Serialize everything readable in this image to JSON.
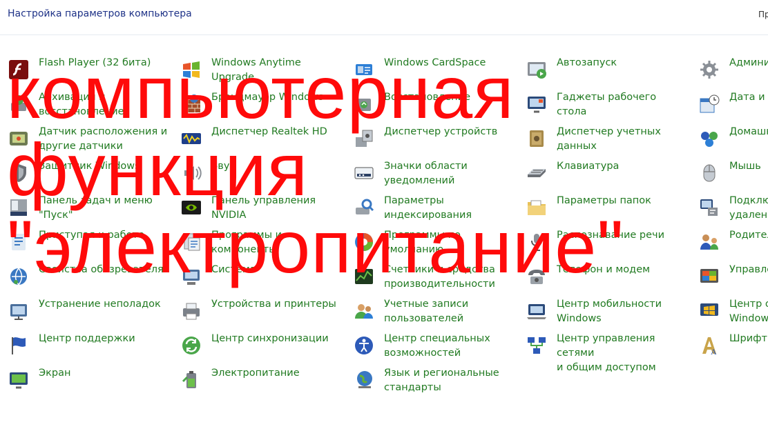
{
  "header": {
    "title": "Настройка параметров компьютера",
    "right_clipped": "Пр"
  },
  "colors": {
    "title": "#1e3287",
    "link": "#217a21",
    "overlay": "#ff0a0a"
  },
  "columns": [
    [
      {
        "name": "flash-player",
        "icon": "flash-player-icon",
        "label": "Flash Player (32 бита)"
      },
      {
        "name": "backup-restore",
        "icon": "backup-restore-icon",
        "label": "Архивация и\nвосстановление"
      },
      {
        "name": "location-sensors",
        "icon": "location-sensor-icon",
        "label": "Датчик расположения и\nдругие датчики"
      },
      {
        "name": "windows-defender",
        "icon": "defender-icon",
        "label": "Защитник Windows"
      },
      {
        "name": "taskbar-start-menu",
        "icon": "taskbar-icon",
        "label": "Панель задач и меню\n\"Пуск\""
      },
      {
        "name": "getting-started",
        "icon": "getting-started-icon",
        "label": "Приступая к работе"
      },
      {
        "name": "internet-options",
        "icon": "internet-options-icon",
        "label": "Свойства обозревателя"
      },
      {
        "name": "troubleshooting",
        "icon": "troubleshooting-icon",
        "label": "Устранение неполадок"
      },
      {
        "name": "action-center",
        "icon": "action-center-flag-icon",
        "label": "Центр поддержки"
      },
      {
        "name": "display",
        "icon": "display-icon",
        "label": "Экран"
      }
    ],
    [
      {
        "name": "windows-anytime-upgrade",
        "icon": "windows-logo-icon",
        "label": "Windows Anytime\nUpgrade"
      },
      {
        "name": "windows-firewall",
        "icon": "firewall-icon",
        "label": "Брандмауэр Windows"
      },
      {
        "name": "realtek-hd-manager",
        "icon": "realtek-icon",
        "label": "Диспетчер Realtek HD"
      },
      {
        "name": "sound",
        "icon": "speaker-icon",
        "label": "Звук"
      },
      {
        "name": "nvidia-control-panel",
        "icon": "nvidia-icon",
        "label": "Панель управления\nNVIDIA"
      },
      {
        "name": "programs-features",
        "icon": "programs-icon",
        "label": "Программы и\nкомпоненты"
      },
      {
        "name": "system",
        "icon": "system-icon",
        "label": "Система"
      },
      {
        "name": "devices-printers",
        "icon": "printer-icon",
        "label": "Устройства и принтеры"
      },
      {
        "name": "sync-center",
        "icon": "sync-icon",
        "label": "Центр синхронизации"
      },
      {
        "name": "power-options",
        "icon": "power-icon",
        "label": "Электропитание"
      }
    ],
    [
      {
        "name": "windows-cardspace",
        "icon": "cardspace-icon",
        "label": "Windows CardSpace"
      },
      {
        "name": "recovery",
        "icon": "recovery-icon",
        "label": "Восстановление"
      },
      {
        "name": "device-manager",
        "icon": "device-manager-icon",
        "label": "Диспетчер устройств"
      },
      {
        "name": "notification-area-icons",
        "icon": "notification-area-icon",
        "label": "Значки области\nуведомлений"
      },
      {
        "name": "indexing-options",
        "icon": "indexing-icon",
        "label": "Параметры\nиндексирования"
      },
      {
        "name": "default-programs",
        "icon": "default-programs-icon",
        "label": "Программы по\nумолчанию"
      },
      {
        "name": "performance-tools",
        "icon": "performance-icon",
        "label": "Счетчики и средства\nпроизводительности"
      },
      {
        "name": "user-accounts",
        "icon": "user-accounts-icon",
        "label": "Учетные записи\nпользователей"
      },
      {
        "name": "ease-of-access",
        "icon": "accessibility-icon",
        "label": "Центр специальных\nвозможностей"
      },
      {
        "name": "region-language",
        "icon": "globe-icon",
        "label": "Язык и региональные\nстандарты"
      }
    ],
    [
      {
        "name": "autoplay",
        "icon": "autoplay-icon",
        "label": "Автозапуск"
      },
      {
        "name": "desktop-gadgets",
        "icon": "gadgets-icon",
        "label": "Гаджеты рабочего стола"
      },
      {
        "name": "credential-manager",
        "icon": "credential-safe-icon",
        "label": "Диспетчер учетных\nданных"
      },
      {
        "name": "keyboard",
        "icon": "keyboard-icon",
        "label": "Клавиатура"
      },
      {
        "name": "folder-options",
        "icon": "folder-icon",
        "label": "Параметры папок"
      },
      {
        "name": "speech-recognition",
        "icon": "microphone-icon",
        "label": "Распознавание речи"
      },
      {
        "name": "phone-modem",
        "icon": "phone-icon",
        "label": "Телефон и модем"
      },
      {
        "name": "windows-mobility-center",
        "icon": "mobility-icon",
        "label": "Центр мобильности\nWindows"
      },
      {
        "name": "network-sharing-center",
        "icon": "network-icon",
        "label": "Центр управления сетями\nи общим доступом"
      }
    ],
    [
      {
        "name": "administrative-tools",
        "icon": "admin-tools-icon",
        "label": "Админи"
      },
      {
        "name": "date-time",
        "icon": "calendar-clock-icon",
        "label": "Дата и в"
      },
      {
        "name": "homegroup",
        "icon": "homegroup-icon",
        "label": "Домашн"
      },
      {
        "name": "mouse",
        "icon": "mouse-icon",
        "label": "Мышь"
      },
      {
        "name": "remoteapp-connections",
        "icon": "remote-connection-icon",
        "label": "Подклю\nудаленн"
      },
      {
        "name": "parental-controls",
        "icon": "parental-icon",
        "label": "Родител"
      },
      {
        "name": "color-management",
        "icon": "color-management-icon",
        "label": "Управле"
      },
      {
        "name": "windows-update",
        "icon": "windows-update-icon",
        "label": "Центр о\nWindow"
      },
      {
        "name": "fonts",
        "icon": "fonts-icon",
        "label": "Шрифты"
      }
    ]
  ],
  "overlay_text": "компьютерная\nфункция\n\"электропитание\""
}
